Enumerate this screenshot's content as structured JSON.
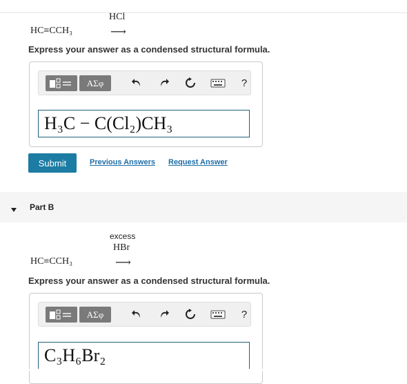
{
  "part_a": {
    "reagent": "HCl",
    "reactant": "HC≡CCH₃",
    "arrow": "⟶",
    "prompt": "Express your answer as a condensed structural formula.",
    "toolbar": {
      "greek_label": "ΑΣφ",
      "help_label": "?"
    },
    "answer_value": "H₃C − C(Cl₂)CH₃",
    "submit_label": "Submit",
    "previous_answers_label": "Previous Answers",
    "request_answer_label": "Request Answer"
  },
  "part_b": {
    "title": "Part B",
    "reagent_line1": "excess",
    "reagent_line2": "HBr",
    "reactant": "HC≡CCH₃",
    "arrow": "⟶",
    "prompt": "Express your answer as a condensed structural formula.",
    "toolbar": {
      "greek_label": "ΑΣφ",
      "help_label": "?"
    },
    "answer_value": "C₃H₆Br₂"
  },
  "icons": {
    "undo": "undo-icon",
    "redo": "redo-icon",
    "reset": "reset-icon",
    "keyboard": "keyboard-icon",
    "collapse": "caret-down-icon",
    "template": "template-icon"
  }
}
